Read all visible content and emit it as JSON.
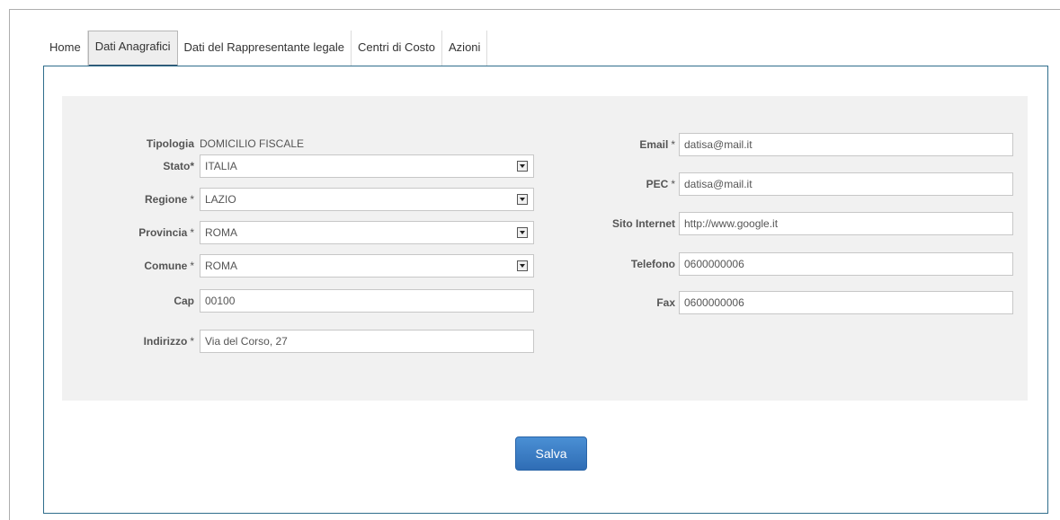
{
  "tabs": [
    {
      "label": "Home"
    },
    {
      "label": "Dati Anagrafici"
    },
    {
      "label": "Dati del Rappresentante legale"
    },
    {
      "label": "Centri di Costo"
    },
    {
      "label": "Azioni"
    }
  ],
  "active_tab": "Dati Anagrafici",
  "left_form": {
    "tipologia": {
      "label": "Tipologia",
      "value": "DOMICILIO FISCALE"
    },
    "stato": {
      "label": "Stato*",
      "value": "ITALIA"
    },
    "regione": {
      "label": "Regione",
      "required_mark": "*",
      "value": "LAZIO"
    },
    "provincia": {
      "label": "Provincia",
      "required_mark": "*",
      "value": "ROMA"
    },
    "comune": {
      "label": "Comune",
      "required_mark": "*",
      "value": "ROMA"
    },
    "cap": {
      "label": "Cap",
      "value": "00100"
    },
    "indirizzo": {
      "label": "Indirizzo",
      "required_mark": "*",
      "value": "Via del Corso, 27"
    }
  },
  "right_form": {
    "email": {
      "label": "Email",
      "required_mark": "*",
      "value": "datisa@mail.it"
    },
    "pec": {
      "label": "PEC",
      "required_mark": "*",
      "value": "datisa@mail.it"
    },
    "sito": {
      "label": "Sito Internet",
      "value": "http://www.google.it"
    },
    "telefono": {
      "label": "Telefono",
      "value": "0600000006"
    },
    "fax": {
      "label": "Fax",
      "value": "0600000006"
    }
  },
  "save_label": "Salva",
  "colors": {
    "accent": "#2f6db5",
    "panel_border": "#2f6d8c",
    "form_bg": "#f1f1f1"
  }
}
